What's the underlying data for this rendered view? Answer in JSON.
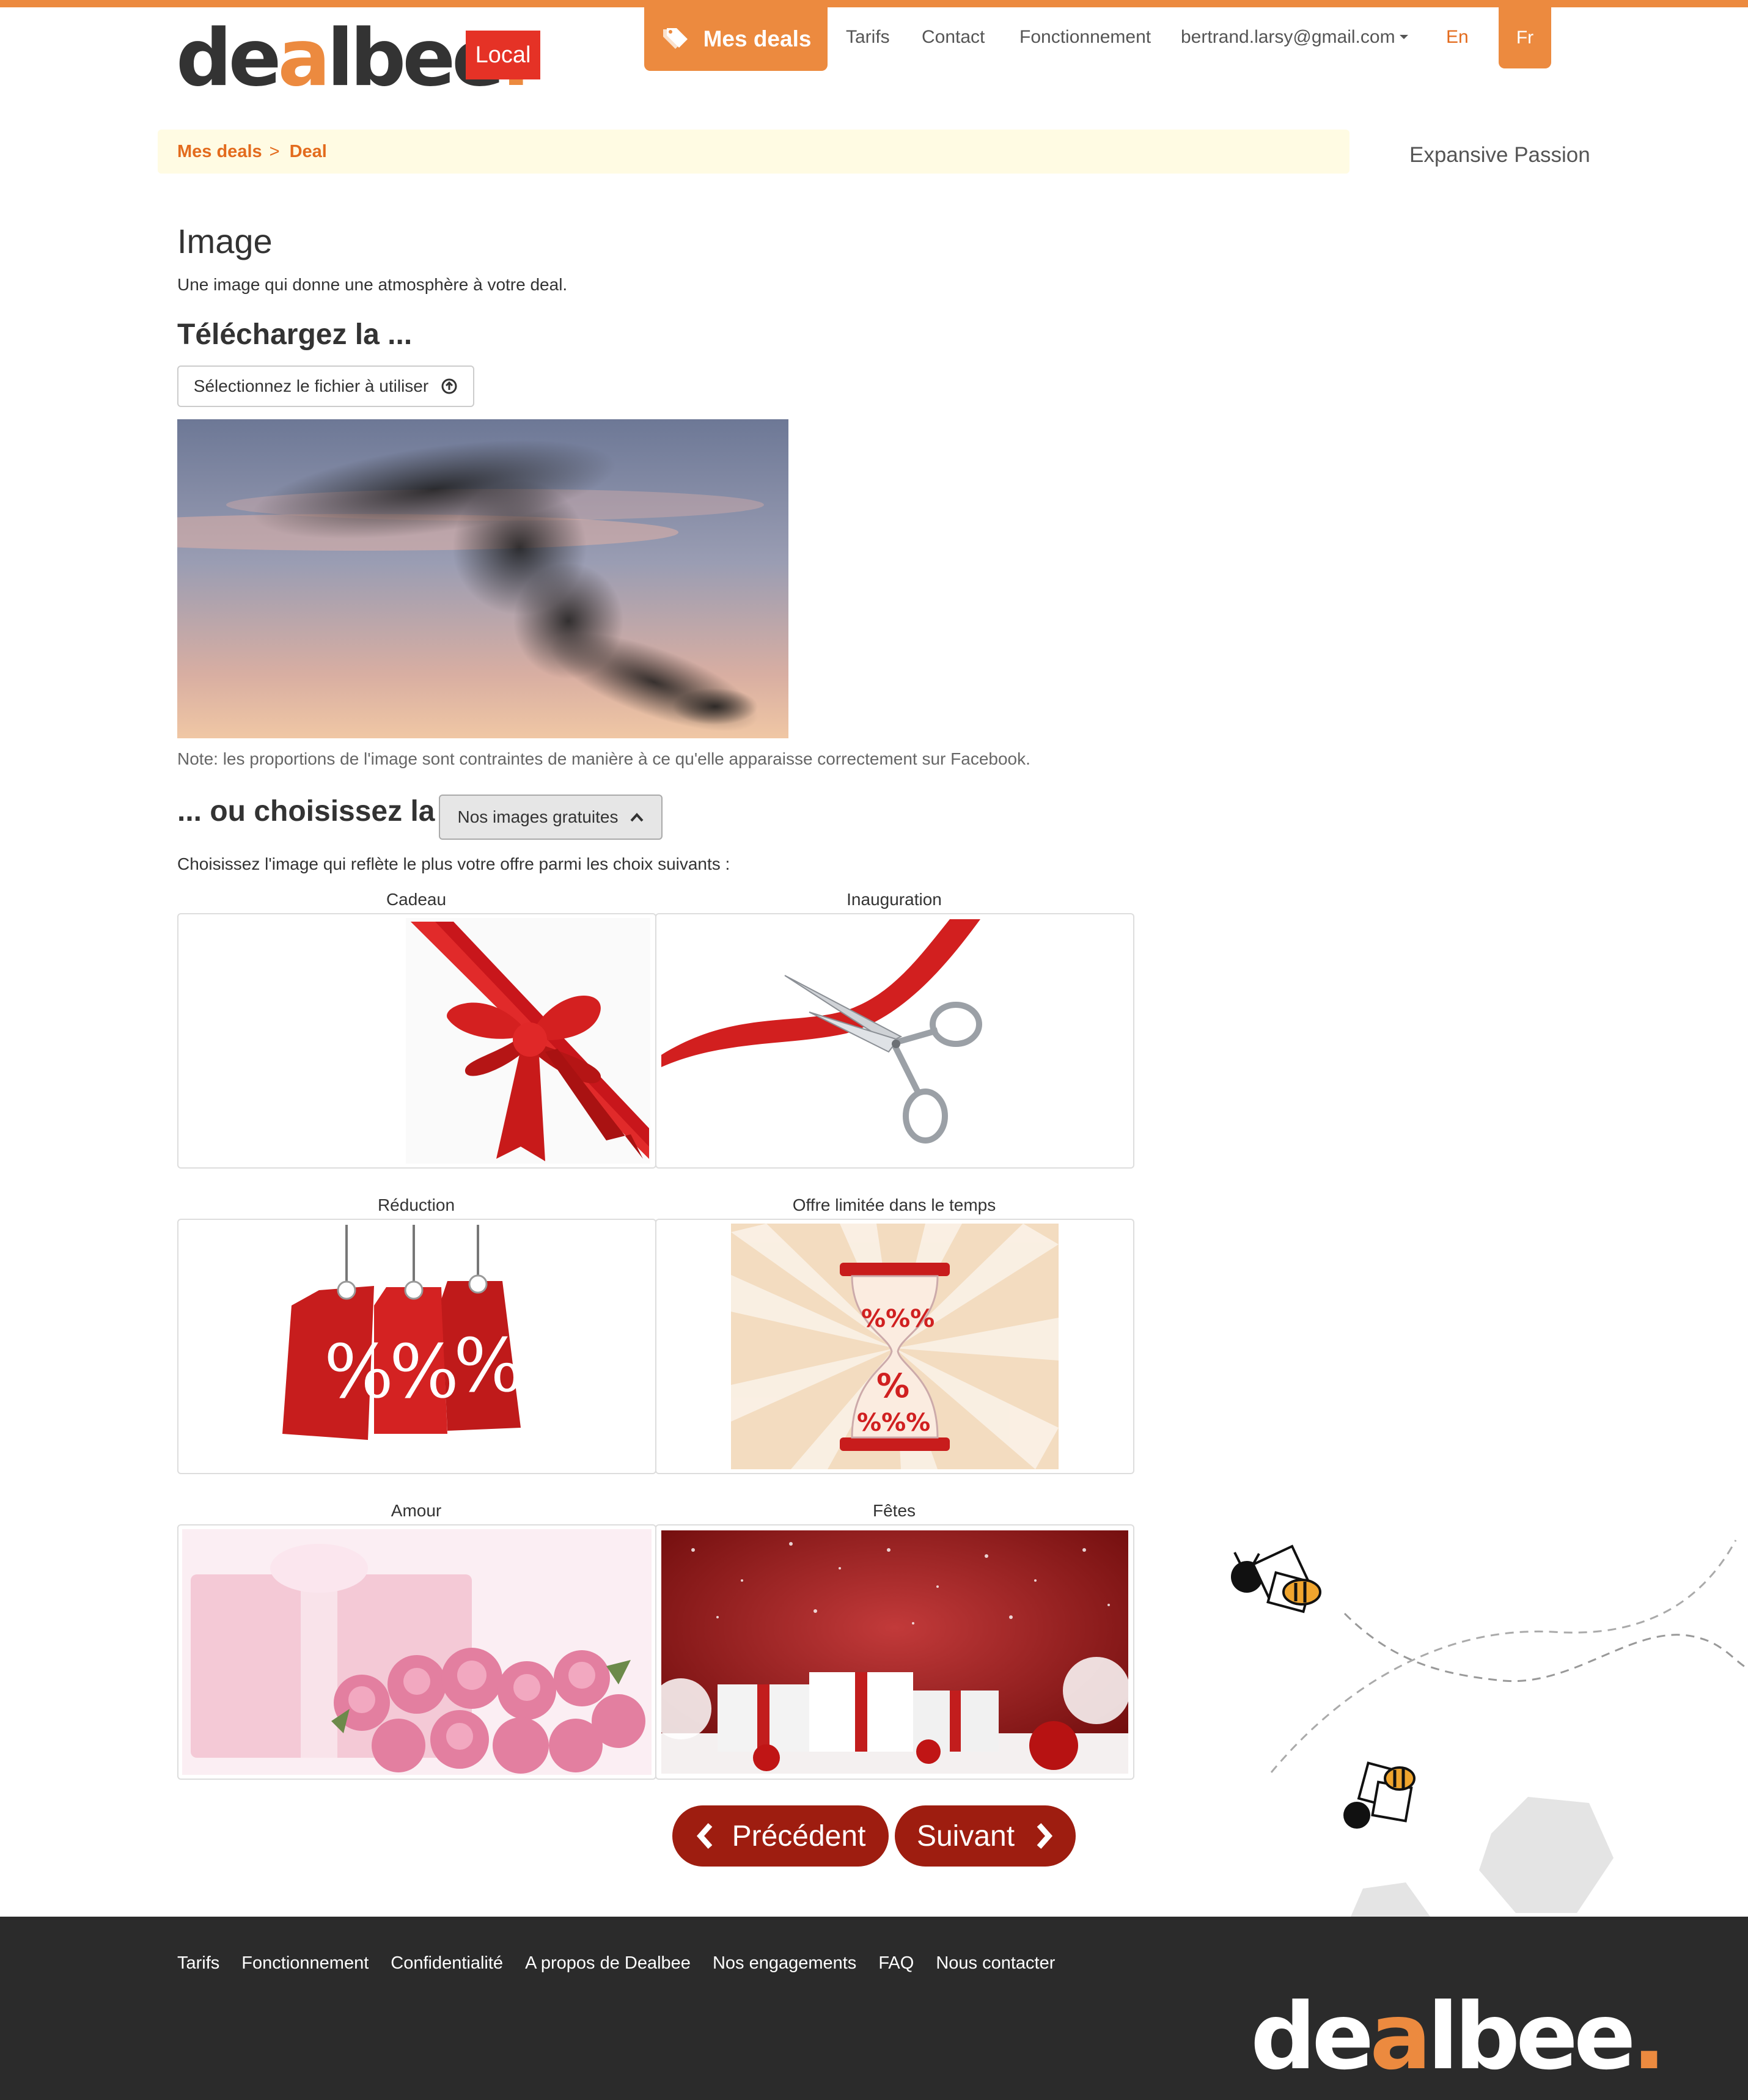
{
  "header": {
    "logo_text_pre": "de",
    "logo_text_a": "a",
    "logo_text_post": "lbee",
    "logo_dot": ".",
    "badge": "Local",
    "nav": {
      "my_deals": "Mes deals",
      "pricing": "Tarifs",
      "contact": "Contact",
      "how_it_works": "Fonctionnement",
      "account": "bertrand.larsy@gmail.com",
      "lang_en": "En",
      "lang_fr": "Fr"
    }
  },
  "breadcrumb": {
    "items": [
      "Mes deals",
      "Deal"
    ],
    "separator": ">"
  },
  "side_title": "Expansive Passion",
  "main": {
    "title": "Image",
    "description": "Une image qui donne une atmosphère à votre deal.",
    "upload_heading": "Téléchargez la ...",
    "file_button": "Sélectionnez le fichier à utiliser",
    "note": "Note: les proportions de l'image sont contraintes de manière à ce qu'elle apparaisse correctement sur Facebook.",
    "or_heading": "... ou choisissez la",
    "free_images_button": "Nos images gratuites",
    "choose_text": "Choisissez l'image qui reflète le plus votre offre parmi les choix suivants :",
    "gallery": [
      "Cadeau",
      "Inauguration",
      "Réduction",
      "Offre limitée dans le temps",
      "Amour",
      "Fêtes"
    ]
  },
  "navigation": {
    "previous": "Précédent",
    "next": "Suivant"
  },
  "footer": {
    "links": [
      "Tarifs",
      "Fonctionnement",
      "Confidentialité",
      "A propos de Dealbee",
      "Nos engagements",
      "FAQ",
      "Nous contacter"
    ]
  },
  "colors": {
    "accent": "#ec8a3f",
    "accent_text": "#e36b1d",
    "badge": "#e53226",
    "nav_button": "#9e1d10",
    "footer": "#2b2b2b",
    "breadcrumb_bg": "#fffbe3"
  },
  "icons": {
    "tag": "tag-icon",
    "upload": "upload-circle-icon",
    "chevron_up": "chevron-up-icon",
    "caret": "caret-down-icon",
    "chevron_left": "chevron-left-icon",
    "chevron_right": "chevron-right-icon"
  }
}
